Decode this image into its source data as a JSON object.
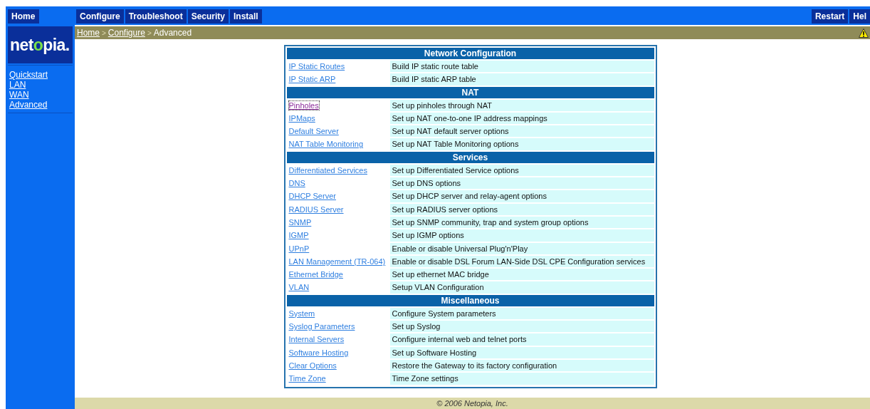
{
  "top_nav": {
    "home": "Home",
    "menu": [
      "Configure",
      "Troubleshoot",
      "Security",
      "Install"
    ],
    "right": [
      "Restart",
      "Hel"
    ]
  },
  "logo": "netopia.",
  "breadcrumb": {
    "links": [
      "Home",
      "Configure"
    ],
    "separator": ">",
    "current": "Advanced",
    "warning": true
  },
  "sidebar": {
    "items": [
      "Quickstart",
      "LAN",
      "WAN",
      "Advanced"
    ]
  },
  "sections": [
    {
      "title": "Network Configuration",
      "rows": [
        {
          "link": "IP Static Routes",
          "description": "Build IP static route table",
          "visited": false
        },
        {
          "link": "IP Static ARP",
          "description": "Build IP static ARP table",
          "visited": false
        }
      ]
    },
    {
      "title": "NAT",
      "rows": [
        {
          "link": "Pinholes",
          "description": "Set up pinholes through NAT",
          "visited": true
        },
        {
          "link": "IPMaps",
          "description": "Set up NAT one-to-one IP address mappings",
          "visited": false
        },
        {
          "link": "Default Server",
          "description": "Set up NAT default server options",
          "visited": false
        },
        {
          "link": "NAT Table Monitoring",
          "description": "Set up NAT Table Monitoring options",
          "visited": false
        }
      ]
    },
    {
      "title": "Services",
      "rows": [
        {
          "link": "Differentiated Services",
          "description": "Set up Differentiated Service options",
          "visited": false
        },
        {
          "link": "DNS",
          "description": "Set up DNS options",
          "visited": false
        },
        {
          "link": "DHCP Server",
          "description": "Set up DHCP server and relay-agent options",
          "visited": false
        },
        {
          "link": "RADIUS Server",
          "description": "Set up RADIUS server options",
          "visited": false
        },
        {
          "link": "SNMP",
          "description": "Set up SNMP community, trap and system group options",
          "visited": false
        },
        {
          "link": "IGMP",
          "description": "Set up IGMP options",
          "visited": false
        },
        {
          "link": "UPnP",
          "description": "Enable or disable Universal Plug'n'Play",
          "visited": false
        },
        {
          "link": "LAN Management (TR-064)",
          "description": "Enable or disable DSL Forum LAN-Side DSL CPE Configuration services",
          "visited": false
        },
        {
          "link": "Ethernet Bridge",
          "description": "Set up ethernet MAC bridge",
          "visited": false
        },
        {
          "link": "VLAN",
          "description": "Setup VLAN Configuration",
          "visited": false
        }
      ]
    },
    {
      "title": "Miscellaneous",
      "rows": [
        {
          "link": "System",
          "description": "Configure System parameters",
          "visited": false
        },
        {
          "link": "Syslog Parameters",
          "description": "Set up Syslog",
          "visited": false
        },
        {
          "link": "Internal Servers",
          "description": "Configure internal web and telnet ports",
          "visited": false
        },
        {
          "link": "Software Hosting",
          "description": "Set up Software Hosting",
          "visited": false
        },
        {
          "link": "Clear Options",
          "description": "Restore the Gateway to its factory configuration",
          "visited": false
        },
        {
          "link": "Time Zone",
          "description": "Time Zone settings",
          "visited": false
        }
      ]
    }
  ],
  "footer": "© 2006 Netopia, Inc."
}
